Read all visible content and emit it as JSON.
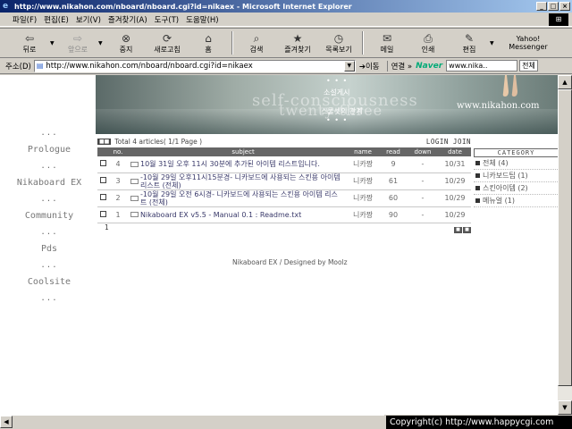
{
  "window": {
    "title": "http://www.nikahon.com/nboard/nboard.cgi?id=nikaex - Microsoft Internet Explorer",
    "buttons": [
      "_",
      "□",
      "×"
    ]
  },
  "menu": [
    "파일(F)",
    "편집(E)",
    "보기(V)",
    "즐겨찾기(A)",
    "도구(T)",
    "도움말(H)"
  ],
  "toolbar": {
    "back": "뒤로",
    "forward": "앞으로",
    "stop": "중지",
    "refresh": "새로고침",
    "home": "홈",
    "search": "검색",
    "favorites": "즐겨찾기",
    "history": "목록보기",
    "mail": "메일",
    "print": "인쇄",
    "edit": "편집",
    "yahoo_line1": "Yahoo!",
    "yahoo_line2": "Messenger"
  },
  "address": {
    "label": "주소(D)",
    "url": "http://www.nikahon.com/nboard/nboard.cgi?id=nikaex",
    "go": "이동",
    "links": "연결 »",
    "naver_logo": "Naver",
    "naver_search": "www.nika..",
    "naver_all": "전체"
  },
  "left_nav": {
    "dots": "...",
    "items": [
      "Prologue",
      "Nikaboard EX",
      "Community",
      "Pds",
      "Coolsite"
    ]
  },
  "banner": {
    "dots": "• • •",
    "kr1": "소설게시",
    "kr2": "스물셋의 관계",
    "text1": "self-consciousness",
    "text2": "twenty-three",
    "url": "www.nikahon.com"
  },
  "board": {
    "total": "Total 4 articles( 1/1 Page )",
    "login": "LOGIN JOIN",
    "columns": [
      "no.",
      "subject",
      "name",
      "read",
      "down",
      "date"
    ],
    "rows": [
      {
        "no": "4",
        "subject": "10월 31일 오후 11시 30분에 추가된 아이템 리스트입니다.",
        "name": "니카짱",
        "read": "9",
        "down": "-",
        "date": "10/31"
      },
      {
        "no": "3",
        "subject": "-10월 29일 오후11시15분경- 니카보드에 사용되는 스킨용 아이템 리스트 (전체)",
        "name": "니카짱",
        "read": "61",
        "down": "-",
        "date": "10/29"
      },
      {
        "no": "2",
        "subject": "-10월 29일 오전 6시경- 니카보드에 사용되는 스킨용 아이템 리스트 (전체)",
        "name": "니카짱",
        "read": "60",
        "down": "-",
        "date": "10/29"
      },
      {
        "no": "1",
        "subject": "Nikaboard EX v5.5 - Manual 0.1 : Readme.txt",
        "name": "니카짱",
        "read": "90",
        "down": "-",
        "date": "10/29"
      }
    ],
    "page": "1",
    "credit": "Nikaboard EX / Designed by Moolz"
  },
  "category": {
    "title": "CATEGORY",
    "items": [
      "전체 (4)",
      "니카보드팁 (1)",
      "스킨아이템 (2)",
      "메뉴얼 (1)"
    ]
  },
  "status": {
    "copyright": "Copyright(c) http://www.happycgi.com"
  }
}
